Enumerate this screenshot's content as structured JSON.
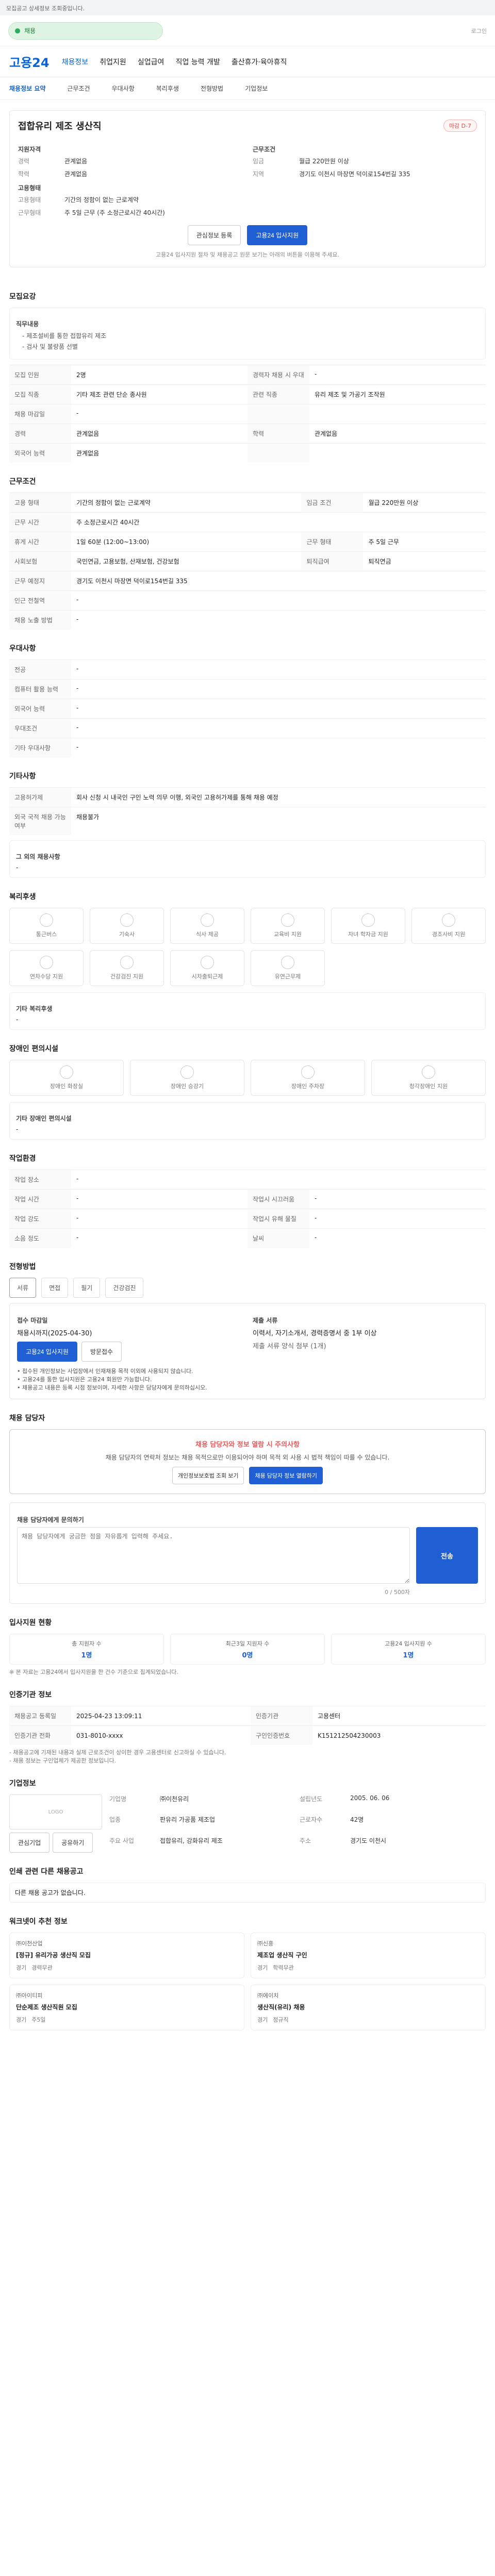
{
  "notice": {
    "text": "모집공고 상세정보 조회중입니다."
  },
  "promo": {
    "label": "채용",
    "right_text": "로그인"
  },
  "header": {
    "logo": "고용24",
    "nav": [
      "채용정보",
      "취업지원",
      "실업급여",
      "직업 능력 개발",
      "출산휴가·육아휴직"
    ],
    "active_index": 0
  },
  "subnav": {
    "items": [
      "채용정보 요약",
      "근무조건",
      "우대사항",
      "복리후생",
      "전형방법",
      "기업정보"
    ],
    "active_index": 0
  },
  "summary": {
    "title": "접합유리 제조 생산직",
    "status_badge": "마감 D-7",
    "left": {
      "section": "지원자격",
      "kv": [
        {
          "k": "경력",
          "v": "관계없음"
        },
        {
          "k": "학력",
          "v": "관계없음"
        }
      ],
      "section2": "고용형태",
      "kv2": [
        {
          "k": "고용형태",
          "v": "기간의 정함이 없는 근로계약"
        },
        {
          "k": "근무형태",
          "v": "주 5일 근무 (주 소정근로시간 40시간)"
        }
      ]
    },
    "right": {
      "section": "근무조건",
      "kv": [
        {
          "k": "임금",
          "v": "월급 220만원 이상"
        },
        {
          "k": "지역",
          "v": "경기도 이천시 마장면 덕이로154번길 335"
        }
      ]
    },
    "buttons": {
      "save": "관심정보 등록",
      "apply": "고용24 입사지원"
    },
    "note": "고용24 입사지원 절차 및 채용공고 원문 보기는 아래의 버튼을 이용해 주세요."
  },
  "sections": {
    "recruit_overview": {
      "title": "모집요강",
      "duties_title": "직무내용",
      "duties": [
        "- 제조설비를 통한 접합유리 제조",
        "- 검사 및 불량품 선별"
      ],
      "rows": [
        {
          "k": "모집 인원",
          "v": "2명",
          "k2": "경력자 채용 시 우대",
          "v2": "-"
        },
        {
          "k": "모집 직종",
          "v": "기타 제조 관련 단순 종사원",
          "k2": "관련 직종",
          "v2": "유리 제조 및 가공기 조작원"
        },
        {
          "k": "채용 마감일",
          "v": "-",
          "k2": "",
          "v2": ""
        },
        {
          "k": "경력",
          "v": "관계없음",
          "k2": "학력",
          "v2": "관계없음"
        },
        {
          "k": "외국어 능력",
          "v": "관계없음",
          "k2": "",
          "v2": ""
        }
      ]
    },
    "work_conditions": {
      "title": "근무조건",
      "rows": [
        {
          "k": "고용 형태",
          "v": "기간의 정함이 없는 근로계약",
          "k2": "임금 조건",
          "v2": "월급 220만원 이상"
        },
        {
          "k": "근무 시간",
          "v": "주 소정근로시간 40시간",
          "k2": "",
          "v2": ""
        },
        {
          "k": "휴게 시간",
          "v": "1일 60분 (12:00~13:00)",
          "k2": "근무 형태",
          "v2": "주 5일 근무"
        },
        {
          "k": "사회보험",
          "v": "국민연금, 고용보험, 산재보험, 건강보험",
          "k2": "퇴직급여",
          "v2": "퇴직연금"
        },
        {
          "k": "근무 예정지",
          "v": "경기도 이천시 마장면 덕이로154번길 335",
          "k2": "",
          "v2": ""
        },
        {
          "k": "인근 전철역",
          "v": "-",
          "k2": "",
          "v2": ""
        },
        {
          "k": "채용 노출 방법",
          "v": "-",
          "k2": "",
          "v2": ""
        }
      ]
    },
    "preferences": {
      "title": "우대사항",
      "rows": [
        {
          "k": "전공",
          "v": "-"
        },
        {
          "k": "컴퓨터 활용 능력",
          "v": "-"
        },
        {
          "k": "외국어 능력",
          "v": "-"
        },
        {
          "k": "우대조건",
          "v": "-"
        },
        {
          "k": "기타 우대사항",
          "v": "-"
        }
      ]
    },
    "others": {
      "title": "기타사항",
      "rows": [
        {
          "k": "고용허가제",
          "v": "회사 신청 시 내국인 구인 노력 의무 이행, 외국인 고용허가제를 통해 채용 예정"
        },
        {
          "k": "외국 국적 채용 가능 여부",
          "v": "채용불가"
        }
      ],
      "note_title": "그 외의 채용사항",
      "note_value": "-"
    },
    "welfare": {
      "title": "복리후생",
      "icons": [
        "통근버스",
        "기숙사",
        "식사 제공",
        "교육비 지원",
        "자녀 학자금 지원",
        "경조사비 지원",
        "연차수당 지원",
        "건강검진 지원",
        "시차출퇴근제",
        "유연근무제"
      ],
      "other_title": "기타 복리후생",
      "other_value": "-"
    },
    "disability": {
      "title": "장애인 편의시설",
      "icons": [
        "장애인 화장실",
        "장애인 승강기",
        "장애인 주차장",
        "청각장애인 지원"
      ],
      "other_title": "기타 장애인 편의시설",
      "other_value": "-"
    },
    "work_env": {
      "title": "작업환경",
      "rows": [
        {
          "k": "작업 장소",
          "v": "-",
          "k2": "",
          "v2": ""
        },
        {
          "k": "작업 시간",
          "v": "-",
          "k2": "작업시 시끄러움",
          "v2": "-"
        },
        {
          "k": "작업 강도",
          "v": "-",
          "k2": "작업시 유해 물질",
          "v2": "-"
        },
        {
          "k": "소음 정도",
          "v": "-",
          "k2": "날씨",
          "v2": "-"
        }
      ]
    },
    "process": {
      "title": "전형방법",
      "tabs": [
        "서류",
        "면접",
        "필기",
        "건강검진"
      ],
      "active_index": 0,
      "apply_method_title": "접수 마감일",
      "apply_method_value": "채용시까지(2025-04-30)",
      "apply_buttons": [
        "고용24 입사지원",
        "방문접수"
      ],
      "apply_docs_title": "제출 서류",
      "apply_docs_value": "이력서, 자기소개서, 경력증명서 중 1부 이상",
      "apply_docs_etc": "제출 서류 양식 첨부 (1개)",
      "notes": [
        "• 접수된 개인정보는 사업장에서 인재채용 목적 이외에 사용되지 않습니다.",
        "• 고용24를 통한 입사지원은 고용24 회원만 가능합니다.",
        "• 채용공고 내용은 등록 시점 정보이며, 자세한 사항은 담당자에게 문의하십시오."
      ]
    },
    "contact": {
      "title": "채용 담당자",
      "alert_title": "채용 담당자와 정보 열람 시 주의사항",
      "alert_text": "채용 담당자의 연락처 정보는 채용 목적으로만 이용되어야 하며 목적 외 사용 시 법적 책임이 따를 수 있습니다.",
      "alert_buttons": [
        "개인정보보호법 조회 보기",
        "채용 담당자 정보 열람하기"
      ],
      "qna_title": "채용 담당자에게 문의하기",
      "qna_placeholder": "채용 담당자에게 궁금한 점을 자유롭게 입력해 주세요.",
      "submit_label": "전송",
      "counter": "0 / 500자"
    },
    "status": {
      "title": "입사지원 현황",
      "stats": [
        {
          "label": "총 지원자 수",
          "value": "1명"
        },
        {
          "label": "최근3일 지원자 수",
          "value": "0명"
        },
        {
          "label": "고용24 입사지원 수",
          "value": "1명"
        }
      ],
      "note": "※ 본 자료는 고용24에서 입사지원을 한 건수 기준으로 집계되었습니다."
    },
    "info": {
      "title": "인증기관 정보",
      "rows": [
        {
          "k": "채용공고 등록일",
          "v": "2025-04-23 13:09:11",
          "k2": "인증기관",
          "v2": "고용센터"
        },
        {
          "k": "인증기관 전화",
          "v": "031-8010-xxxx",
          "k2": "구인인증번호",
          "v2": "K151212504230003"
        }
      ],
      "footnotes": [
        "- 채용공고에 기재된 내용과 실제 근로조건이 상이한 경우 고용센터로 신고하실 수 있습니다.",
        "- 채용 정보는 구인업체가 제공한 정보입니다."
      ]
    },
    "company": {
      "title": "기업정보",
      "logo_text": "LOGO",
      "buttons": [
        "관심기업",
        "공유하기"
      ],
      "kv": [
        {
          "k": "기업명",
          "v": "㈜이천유리",
          "k2": "설립년도",
          "v2": "2005. 06. 06"
        },
        {
          "k": "업종",
          "v": "판유리 가공품 제조업",
          "k2": "근로자수",
          "v2": "42명"
        },
        {
          "k": "주요 사업",
          "v": "접합유리, 강화유리 제조",
          "k2": "주소",
          "v2": "경기도 이천시"
        }
      ]
    },
    "more_jobs": {
      "title": "인쇄 관련 다른 채용공고",
      "empty": "다른 채용 공고가 없습니다."
    },
    "recommend": {
      "title": "워크넷이 추천 정보",
      "jobs": [
        {
          "co": "㈜이천산업",
          "title": "[정규] 유리가공 생산직 모집",
          "meta": [
            "경기",
            "경력무관"
          ]
        },
        {
          "co": "㈜신흥",
          "title": "제조업 생산직 구인",
          "meta": [
            "경기",
            "학력무관"
          ]
        },
        {
          "co": "㈜아이티피",
          "title": "단순제조 생산직원 모집",
          "meta": [
            "경기",
            "주5일"
          ]
        },
        {
          "co": "㈜에이치",
          "title": "생산직(유리) 채용",
          "meta": [
            "경기",
            "정규직"
          ]
        }
      ]
    }
  }
}
